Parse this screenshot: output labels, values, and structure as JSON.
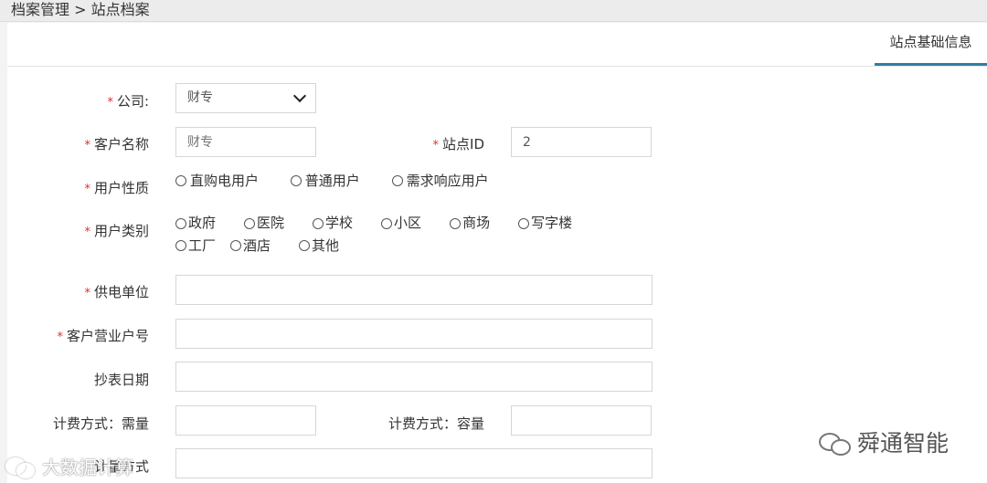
{
  "breadcrumb": "档案管理 > 站点档案",
  "tabs": {
    "active": "站点基础信息"
  },
  "form": {
    "company": {
      "label": "公司:",
      "value": "财专"
    },
    "customer_name": {
      "label": "客户名称",
      "placeholder": "财专"
    },
    "site_id": {
      "label": "站点ID",
      "value": "2"
    },
    "user_nature": {
      "label": "用户性质",
      "options": [
        "直购电用户",
        "普通用户",
        "需求响应用户"
      ]
    },
    "user_category": {
      "label": "用户类别",
      "options": [
        "政府",
        "医院",
        "学校",
        "小区",
        "商场",
        "写字楼",
        "工厂",
        "酒店",
        "其他"
      ]
    },
    "power_unit": {
      "label": "供电单位",
      "value": ""
    },
    "business_account": {
      "label": "客户营业户号",
      "value": ""
    },
    "meter_date": {
      "label": "抄表日期",
      "value": ""
    },
    "billing_demand": {
      "label": "计费方式：需量",
      "value": ""
    },
    "billing_capacity": {
      "label": "计费方式：容量",
      "value": ""
    },
    "billing_quantity": {
      "label": "计量方式",
      "value": ""
    }
  },
  "watermarks": {
    "right": "舜通智能",
    "left": "大数据计算"
  }
}
